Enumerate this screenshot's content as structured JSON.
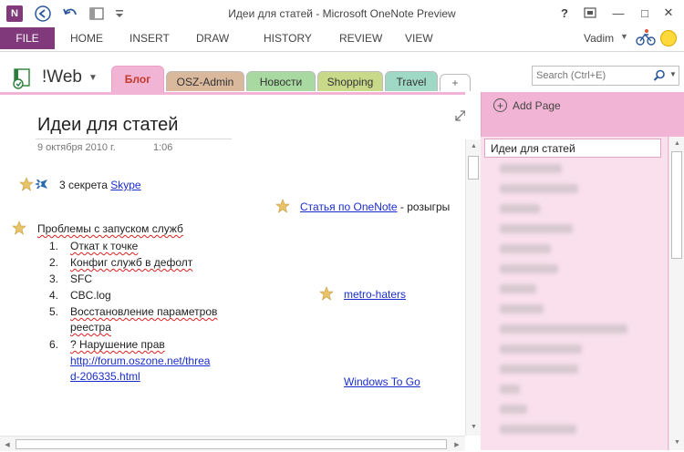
{
  "window": {
    "title": "Идеи для статей - Microsoft OneNote Preview",
    "app_icon_letter": "N",
    "help": "?",
    "fullscreen_icon": "fullscreen-icon",
    "minimize": "—",
    "maximize": "□",
    "close": "✕"
  },
  "ribbon": {
    "file": "FILE",
    "tabs": [
      "HOME",
      "INSERT",
      "DRAW",
      "HISTORY",
      "REVIEW",
      "VIEW"
    ],
    "user": "Vadim"
  },
  "notebook": {
    "name": "!Web",
    "sections": [
      {
        "label": "Блог",
        "color": "#f2b4d4",
        "active": true
      },
      {
        "label": "OSZ-Admin",
        "color": "#d9b89c",
        "active": false
      },
      {
        "label": "Новости",
        "color": "#a8d9a0",
        "active": false
      },
      {
        "label": "Shopping",
        "color": "#c9d98a",
        "active": false
      },
      {
        "label": "Travel",
        "color": "#9fd9c5",
        "active": false
      }
    ],
    "new_section": "+"
  },
  "search": {
    "placeholder": "Search (Ctrl+E)"
  },
  "page": {
    "title": "Идеи для статей",
    "date": "9 октября 2010 г.",
    "time": "1:06",
    "note1_text": "3 секрета ",
    "note1_link": "Skype",
    "note2_link": "Статья по OneNote",
    "note2_text": " - розыгры",
    "list_title": "Проблемы с запуском служб",
    "list": [
      {
        "num": "1.",
        "lines": [
          "Откат к точке"
        ]
      },
      {
        "num": "2.",
        "lines": [
          "Конфиг служб в дефолт"
        ]
      },
      {
        "num": "3.",
        "lines": [
          "SFC"
        ]
      },
      {
        "num": "4.",
        "lines": [
          "CBC.log"
        ]
      },
      {
        "num": "5.",
        "lines": [
          "Восстановление параметров",
          "реестра"
        ]
      },
      {
        "num": "6.",
        "lines": [
          "? Нарушение прав"
        ],
        "link_lines": [
          "http://forum.oszone.net/threa",
          "d-206335.html"
        ]
      }
    ],
    "note3_link": "metro-haters",
    "note4_link": "Windows To Go"
  },
  "pages_pane": {
    "add_page": "Add Page",
    "selected_page": "Идеи для статей"
  },
  "colors": {
    "file_tab": "#80397b",
    "section_pink": "#f2b4d4",
    "link": "#1a2ecc"
  }
}
